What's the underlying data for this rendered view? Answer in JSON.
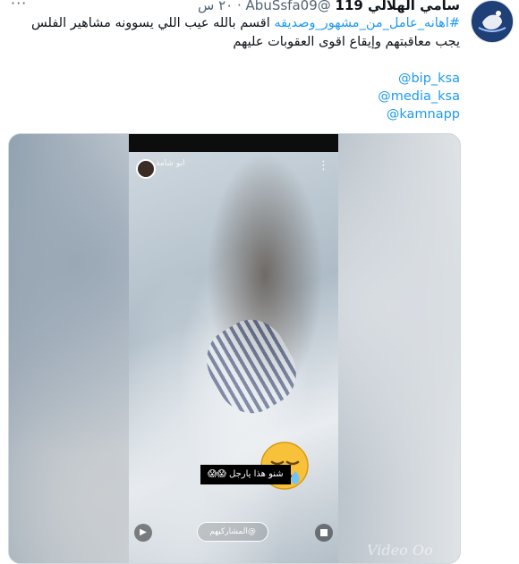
{
  "tweet": {
    "display_name": "سامي الهلالي 119",
    "handle": "@AbuSsfa09",
    "separator": "·",
    "time": "٢٠ س",
    "more_label": "···",
    "hashtag": "#اهانه_عامل_من_مشهور_وصديقه",
    "text_line1": "اقسم بالله عيب اللي يسوونه مشاهير الفلس",
    "text_line2": "يجب معاقبتهم وإيقاع اقوى العقوبات عليهم",
    "mentions": [
      "@bip_ksa",
      "@media_ksa",
      "@kamnapp"
    ]
  },
  "media": {
    "story_user": "ابو شامة",
    "story_menu": "⋮",
    "caption_text": "شنو هذا يارجل",
    "caption_emoji": "😱😱",
    "reply_text": "@المشاركيهم",
    "send_icon": "▶",
    "watermark": "Video Oo"
  },
  "icons": {
    "avatar": "profile-avatar",
    "more": "more-options-icon",
    "emoji": "sleepy-face-emoji"
  },
  "colors": {
    "link": "#1d9bf0",
    "text": "#0f1419",
    "muted": "#536471"
  }
}
